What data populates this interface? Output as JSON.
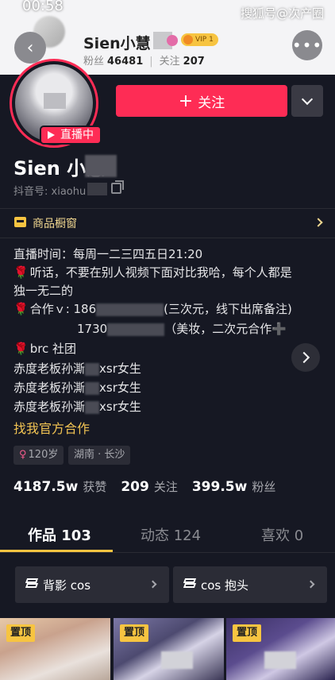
{
  "status_bar": {
    "time": "00:58"
  },
  "watermark": "搜狐号@次产圈",
  "header": {
    "name": "Sien小慧",
    "vip_badge": "VIP 1",
    "fans_label": "粉丝",
    "fans_count": "46481",
    "following_label": "关注",
    "following_count": "207",
    "more_label": "•••"
  },
  "profile": {
    "live_tag": "直播中",
    "follow_label": "关注",
    "name": "Sien 小慧",
    "douyin_id_label": "抖音号:",
    "douyin_id_value": "xiaohu"
  },
  "shop_window": {
    "label": "商品橱窗"
  },
  "bio": {
    "line1": "直播时间：每周一二三四五日21:20",
    "line2": "听话，不要在别人视频下面对比我哈，每个人都是",
    "line3": "独一无二的",
    "line4_prefix": "合作ｖ: 186",
    "line4_suffix": "(三次元，线下出席备注)",
    "line5_prefix": "1730",
    "line5_suffix": "（美妆，二次元合作",
    "line6": "brc 社团",
    "line7_prefix": "赤度老板孙澌",
    "line7_suffix": "xsr女生",
    "line8_prefix": "赤度老板孙澌",
    "line8_suffix": "xsr女生",
    "line9_prefix": "赤度老板孙澌",
    "line9_suffix": "xsr女生",
    "rose": "🌹",
    "plus_icon": "➕"
  },
  "official_cooperation": "找我官方合作",
  "chips": {
    "age": "120岁",
    "location": "湖南 · 长沙"
  },
  "stats": {
    "likes_value": "4187.5w",
    "likes_label": "获赞",
    "following_value": "209",
    "following_label": "关注",
    "fans_value": "399.5w",
    "fans_label": "粉丝"
  },
  "tabs": [
    {
      "label": "作品 103"
    },
    {
      "label": "动态 124"
    },
    {
      "label": "喜欢 0"
    }
  ],
  "collections": [
    {
      "label": "背影 cos"
    },
    {
      "label": "cos 抱头"
    }
  ],
  "thumbnails": [
    {
      "pin": "置顶"
    },
    {
      "pin": "置顶"
    },
    {
      "pin": "置顶"
    }
  ],
  "colors": {
    "accent_red": "#fe2c55",
    "gold": "#f7c441",
    "background": "#161823"
  }
}
